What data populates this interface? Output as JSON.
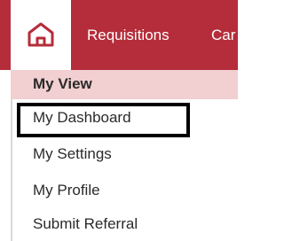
{
  "nav": {
    "home_icon": "home-icon",
    "requisitions_label": "Requisitions",
    "partial_label": "Car"
  },
  "menu": {
    "header": "My View",
    "items": [
      {
        "label": "My Dashboard",
        "highlighted": true
      },
      {
        "label": "My Settings"
      },
      {
        "label": "My Profile"
      },
      {
        "label": "Submit Referral"
      }
    ]
  },
  "colors": {
    "brand_red": "#b52d3a",
    "header_pink": "#f2cfd1"
  }
}
